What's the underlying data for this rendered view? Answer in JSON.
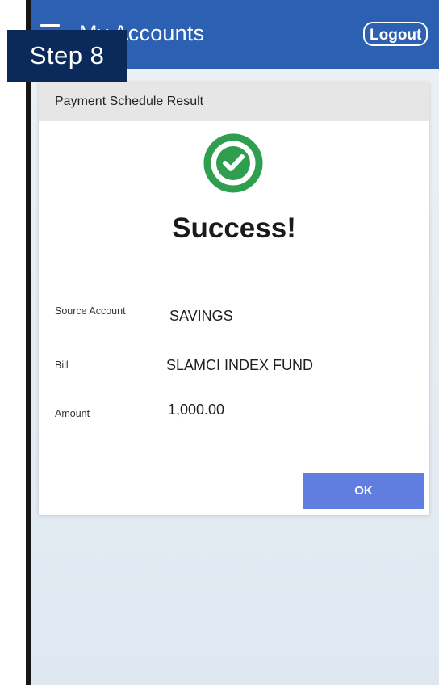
{
  "app": {
    "title": "My Accounts",
    "logout_label": "Logout",
    "bar_color": "#2b60b3"
  },
  "overlay": {
    "step_label": "Step 8"
  },
  "dialog": {
    "title": "Payment Schedule Result",
    "status_icon": "check-circle-icon",
    "status_text": "Success!",
    "details": [
      {
        "label": "Source Account",
        "value": "SAVINGS"
      },
      {
        "label": "Bill",
        "value": "SLAMCI INDEX FUND"
      },
      {
        "label": "Amount",
        "value": "1,000.00"
      }
    ],
    "ok_label": "OK",
    "ok_color": "#5f7ee0",
    "success_color": "#2f9e4f"
  }
}
